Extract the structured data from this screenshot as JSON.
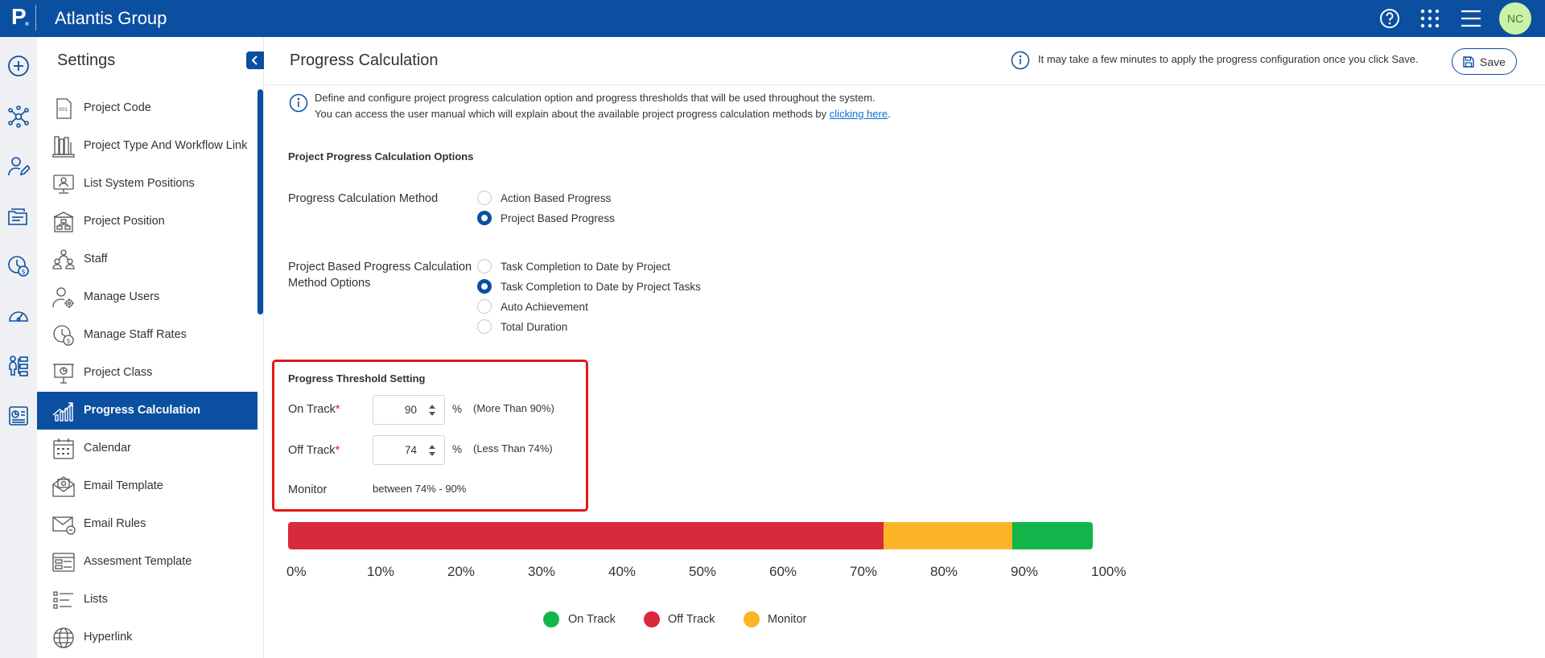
{
  "app": {
    "logo": "P",
    "company": "Atlantis Group",
    "user_initials": "NC"
  },
  "colors": {
    "brand": "#0b4fa0",
    "on_track": "#12b54a",
    "off_track": "#d9293d",
    "monitor": "#fbb526",
    "highlight": "#e0191a"
  },
  "topbar_icons": [
    "help-icon",
    "apps-grid-icon",
    "menu-icon"
  ],
  "rail_icons": [
    "add-icon",
    "network-icon",
    "user-edit-icon",
    "folder-icon",
    "clock-dollar-icon",
    "dashboard-icon",
    "org-chart-icon",
    "report-icon"
  ],
  "sidebar": {
    "title": "Settings",
    "items": [
      {
        "label": "Project Code",
        "icon": "code-doc-icon"
      },
      {
        "label": "Project Type And Workflow Link",
        "icon": "books-icon"
      },
      {
        "label": "List System Positions",
        "icon": "monitor-user-icon"
      },
      {
        "label": "Project Position",
        "icon": "hierarchy-icon"
      },
      {
        "label": "Staff",
        "icon": "staff-icon"
      },
      {
        "label": "Manage Users",
        "icon": "user-gear-icon"
      },
      {
        "label": "Manage Staff Rates",
        "icon": "clock-rate-icon"
      },
      {
        "label": "Project Class",
        "icon": "presentation-icon"
      },
      {
        "label": "Progress Calculation",
        "icon": "growth-chart-icon",
        "active": true
      },
      {
        "label": "Calendar",
        "icon": "calendar-icon"
      },
      {
        "label": "Email Template",
        "icon": "email-template-icon"
      },
      {
        "label": "Email Rules",
        "icon": "email-rules-icon"
      },
      {
        "label": "Assesment Template",
        "icon": "form-template-icon"
      },
      {
        "label": "Lists",
        "icon": "list-icon"
      },
      {
        "label": "Hyperlink",
        "icon": "globe-icon"
      }
    ]
  },
  "main": {
    "title": "Progress Calculation",
    "info_note": "It may take a few minutes to apply the progress configuration once you click Save.",
    "save_label": "Save",
    "intro_line1": "Define and configure project progress calculation option and progress thresholds that will be used throughout the system.",
    "intro_line2": "You can access the user manual which will explain about the available project progress calculation methods by",
    "intro_link": "clicking here",
    "intro_end": ".",
    "options_heading": "Project Progress Calculation Options",
    "method_label": "Progress Calculation Method",
    "method_options": [
      {
        "label": "Action Based Progress",
        "checked": false
      },
      {
        "label": "Project Based Progress",
        "checked": true
      }
    ],
    "pb_label_line1": "Project Based Progress Calculation",
    "pb_label_line2": "Method Options",
    "pb_options": [
      {
        "label": "Task Completion to Date by Project",
        "checked": false
      },
      {
        "label": "Task Completion to Date by Project Tasks",
        "checked": true
      },
      {
        "label": "Auto Achievement",
        "checked": false
      },
      {
        "label": "Total Duration",
        "checked": false
      }
    ],
    "threshold_heading": "Progress Threshold Setting",
    "on_track_label": "On Track",
    "on_track_value": "90",
    "on_track_hint": "(More Than 90%)",
    "off_track_label": "Off Track",
    "off_track_value": "74",
    "off_track_hint": "(Less Than 74%)",
    "required_mark": "*",
    "pct": "%",
    "monitor_label": "Monitor",
    "monitor_value": "between 74% - 90%"
  },
  "progress_bar": {
    "off_track_end_pct": 74,
    "monitor_end_pct": 90,
    "tick_labels": [
      "0%",
      "10%",
      "20%",
      "30%",
      "40%",
      "50%",
      "60%",
      "70%",
      "80%",
      "90%",
      "100%"
    ],
    "legend": [
      {
        "label": "On Track",
        "color_key": "on_track"
      },
      {
        "label": "Off Track",
        "color_key": "off_track"
      },
      {
        "label": "Monitor",
        "color_key": "monitor"
      }
    ]
  }
}
